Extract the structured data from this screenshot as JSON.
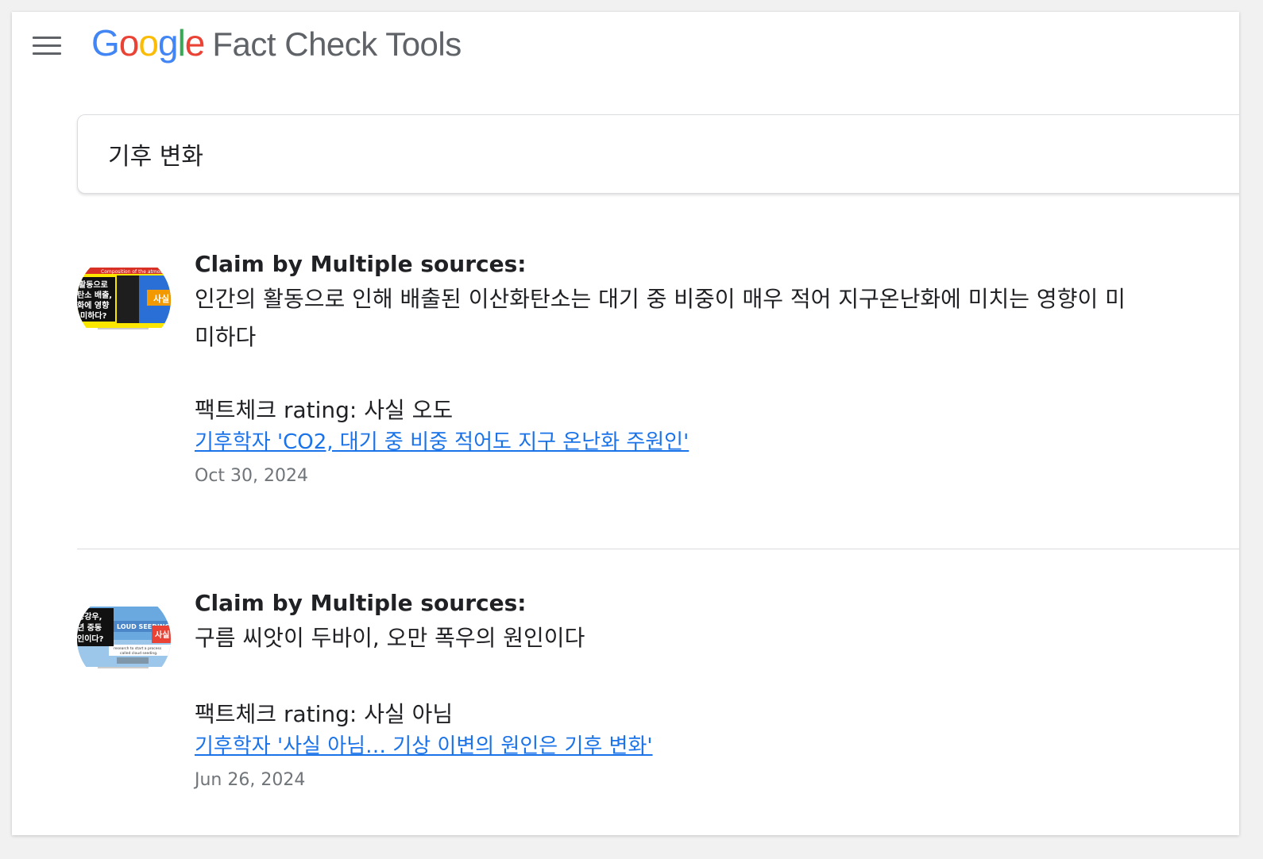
{
  "header": {
    "logo_letters": [
      "G",
      "o",
      "o",
      "g",
      "l",
      "e"
    ],
    "product": "Fact Check Tools"
  },
  "search": {
    "value": "기후 변화"
  },
  "results": [
    {
      "claimant": "Claim by Multiple sources:",
      "claim_line1": "인간의 활동으로 인해 배출된 이산화탄소는 대기 중 비중이 매우 적어 지구온난화에 미치는 영향이 미",
      "claim_line2": "미하다",
      "rating": "팩트체크 rating: 사실 오도",
      "link_text": "기후학자 'CO2, 대기 중 비중 적어도 지구 온난화 주원인'",
      "date": "Oct 30, 2024",
      "thumb": {
        "banner": "Composition of the atmos",
        "lines": [
          "활동으로",
          "탄소 배출,",
          "화에 영향",
          "미하다?"
        ],
        "tag": "사실"
      }
    },
    {
      "claimant": "Claim by Multiple sources:",
      "claim_line1": "구름 씨앗이 두바이, 오만 폭우의 원인이다",
      "rating": "팩트체크 rating: 사실 아님",
      "link_text": "기후학자 '사실 아님… 기상 이변의 원인은 기후 변화'",
      "date": "Jun 26, 2024",
      "thumb": {
        "banner": "LOUD SEEDING",
        "lines": [
          "공강우,",
          "년 중동",
          "인이다?"
        ],
        "tag": "사실",
        "caption1": "research to start a process",
        "caption2": "called cloud seeding."
      }
    }
  ],
  "colors": {
    "link": "#1a73e8",
    "google_blue": "#4285F4",
    "google_red": "#EA4335",
    "google_yellow": "#FBBC05",
    "google_green": "#34A853"
  }
}
